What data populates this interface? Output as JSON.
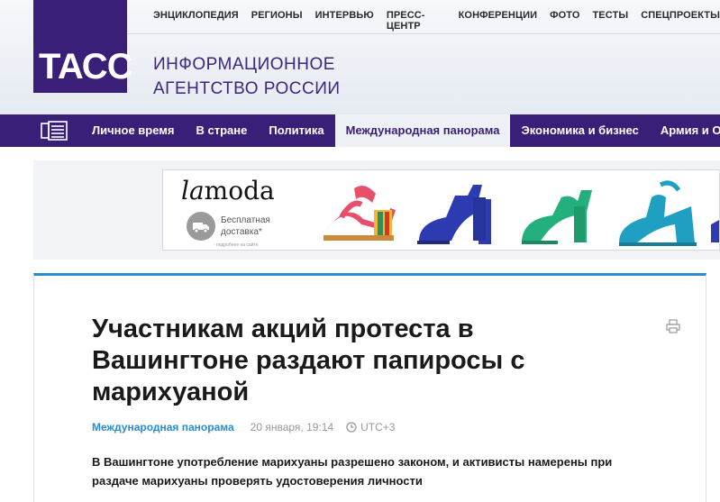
{
  "header": {
    "logo_text": "ТАСС",
    "agency_line1": "ИНФОРМАЦИОННОЕ",
    "agency_line2": "АГЕНТСТВО РОССИИ",
    "top_nav": [
      "ЭНЦИКЛОПЕДИЯ",
      "РЕГИОНЫ",
      "ИНТЕРВЬЮ",
      "ПРЕСС-ЦЕНТР",
      "КОНФЕРЕНЦИИ",
      "ФОТО",
      "ТЕСТЫ",
      "СПЕЦПРОЕКТЫ"
    ]
  },
  "main_nav": {
    "items": [
      "Личное время",
      "В стране",
      "Политика",
      "Международная панорама",
      "Экономика и бизнес",
      "Армия и ОПК"
    ],
    "active_index": 3
  },
  "ad": {
    "brand_part1": "la",
    "brand_part2": "moda",
    "delivery_line1": "Бесплатная",
    "delivery_line2": "доставка*",
    "fine_print": "- подробнее на сайте",
    "icon": "truck-icon"
  },
  "article": {
    "title": "Участникам акций протеста в Вашингтоне раздают папиросы с марихуаной",
    "rubric": "Международная панорама",
    "date": "20 января, 19:14",
    "timezone": "UTC+3",
    "lead": "В Вашингтоне употребление марихуаны разрешено законом, и активисты намерены при раздаче марихуаны проверять удостоверения личности"
  },
  "colors": {
    "brand_purple": "#3a1f78",
    "accent_blue": "#2a8dd4"
  }
}
